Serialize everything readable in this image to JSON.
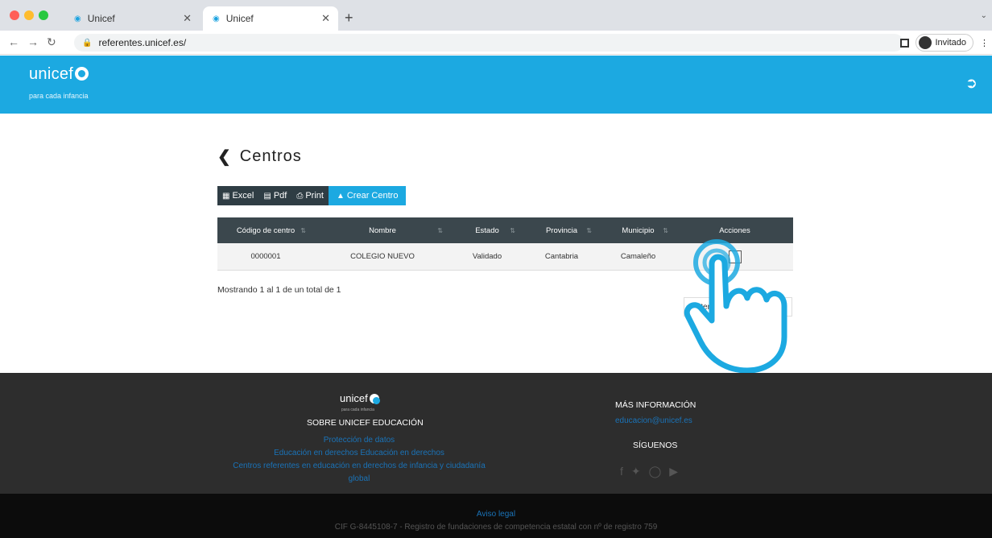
{
  "browser": {
    "tabs": [
      {
        "title": "Unicef",
        "active": false
      },
      {
        "title": "Unicef",
        "active": true
      }
    ],
    "url": "referentes.unicef.es/",
    "profile_label": "Invitado"
  },
  "header": {
    "logo_text": "unicef",
    "logo_tagline": "para cada infancia",
    "logout_icon": "sign-out-icon"
  },
  "main": {
    "title": "Centros",
    "toolbar": {
      "excel": "Excel",
      "pdf": "Pdf",
      "print": "Print",
      "create": "Crear Centro"
    },
    "table": {
      "columns": [
        "Código de centro",
        "Nombre",
        "Estado",
        "Provincia",
        "Municipio",
        "Acciones"
      ],
      "rows": [
        [
          "0000001",
          "COLEGIO NUEVO",
          "Validado",
          "Cantabria",
          "Camaleño"
        ]
      ]
    },
    "showing": "Mostrando 1 al 1 de un total de 1",
    "pager_prev": "Anterior"
  },
  "footer": {
    "logo_text": "unicef",
    "logo_tagline": "para cada infancia",
    "about_title": "SOBRE UNICEF EDUCACIÓN",
    "links": [
      "Protección de datos",
      "Educación en derechos Educación en derechos",
      "Centros referentes en educación en derechos de infancia y ciudadanía",
      "global"
    ],
    "more_info_title": "MÁS INFORMACIÓN",
    "email": "educacion@unicef.es",
    "follow_title": "SÍGUENOS",
    "aviso": "Aviso legal",
    "cif": "CIF G-8445108-7 - Registro de fundaciones de competencia estatal con nº de registro 759"
  },
  "colors": {
    "brand": "#1ca9e1",
    "table_header": "#3b474d",
    "footer": "#2d2d2d"
  }
}
